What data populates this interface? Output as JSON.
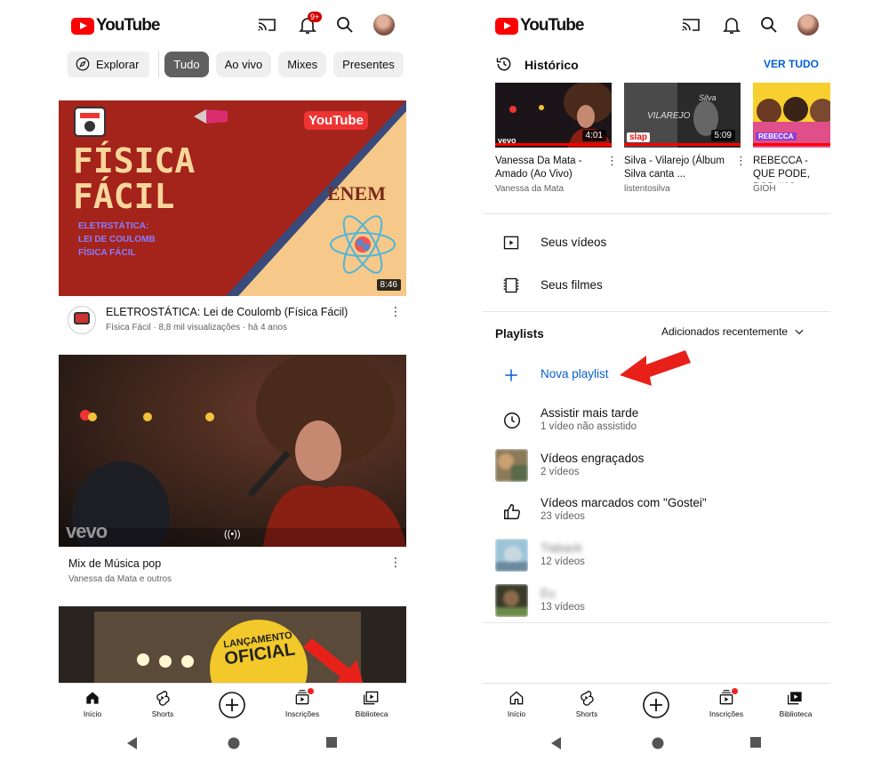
{
  "colors": {
    "youtube_red": "#ff0000",
    "accent_blue": "#065fd4",
    "arrow_red": "#e8201a",
    "chip_active": "#606060"
  },
  "left": {
    "logo_text": "YouTube",
    "notification_badge": "9+",
    "chips": [
      "Explorar",
      "Tudo",
      "Ao vivo",
      "Mixes",
      "Presentes"
    ],
    "active_chip": "Tudo",
    "videos": [
      {
        "thumb_title_line1": "FÍSICA",
        "thumb_title_line2": "FÁCIL",
        "thumb_subtitle": [
          "ELETRSTÁTICA:",
          "LEI DE COULOMB",
          "FÍSICA FÁCIL"
        ],
        "thumb_enem": "ENEM",
        "thumb_youtube_logo": "YouTube",
        "duration": "8:46",
        "title": "ELETROSTÁTICA: Lei de Coulomb (Física Fácil)",
        "meta": "Física Fácil · 8,8 mil visualizações · há 4 anos"
      },
      {
        "watermark": "vevo",
        "title": "Mix de Música pop",
        "meta": "Vanessa da Mata e outros"
      },
      {
        "thumb_badge_line1": "LANÇAMENTO",
        "thumb_badge_line2": "OFICIAL"
      }
    ],
    "nav": [
      "Início",
      "Shorts",
      "",
      "Inscrições",
      "Biblioteca"
    ]
  },
  "right": {
    "logo_text": "YouTube",
    "history_title": "Histórico",
    "history_link": "VER TUDO",
    "history": [
      {
        "title": "Vanessa Da Mata - Amado (Ao Vivo)",
        "channel": "Vanessa da Mata",
        "duration": "4:01",
        "label": "vevo"
      },
      {
        "title": "Silva - Vilarejo (Álbum Silva canta ...",
        "channel": "listentosilva",
        "duration": "5:09",
        "label": "slap",
        "thumb_text1": "VILAREJO",
        "thumb_text2": "Silva"
      },
      {
        "title": "REBECCA - QUE PODE, POD #12",
        "channel": "GIOH",
        "label": "REBECCA"
      }
    ],
    "rows": [
      {
        "label": "Seus vídeos"
      },
      {
        "label": "Seus filmes"
      }
    ],
    "playlists_title": "Playlists",
    "sort_label": "Adicionados recentemente",
    "new_playlist": "Nova playlist",
    "playlists": [
      {
        "name": "Assistir mais tarde",
        "count": "1 vídeo não assistido"
      },
      {
        "name": "Vídeos engraçados",
        "count": "2 vídeos"
      },
      {
        "name": "Vídeos marcados com \"Gostei\"",
        "count": "23 vídeos"
      },
      {
        "name": "Tiaback",
        "count": "12 vídeos"
      },
      {
        "name": "Eu",
        "count": "13 vídeos"
      }
    ],
    "nav": [
      "Início",
      "Shorts",
      "",
      "Inscrições",
      "Biblioteca"
    ]
  }
}
